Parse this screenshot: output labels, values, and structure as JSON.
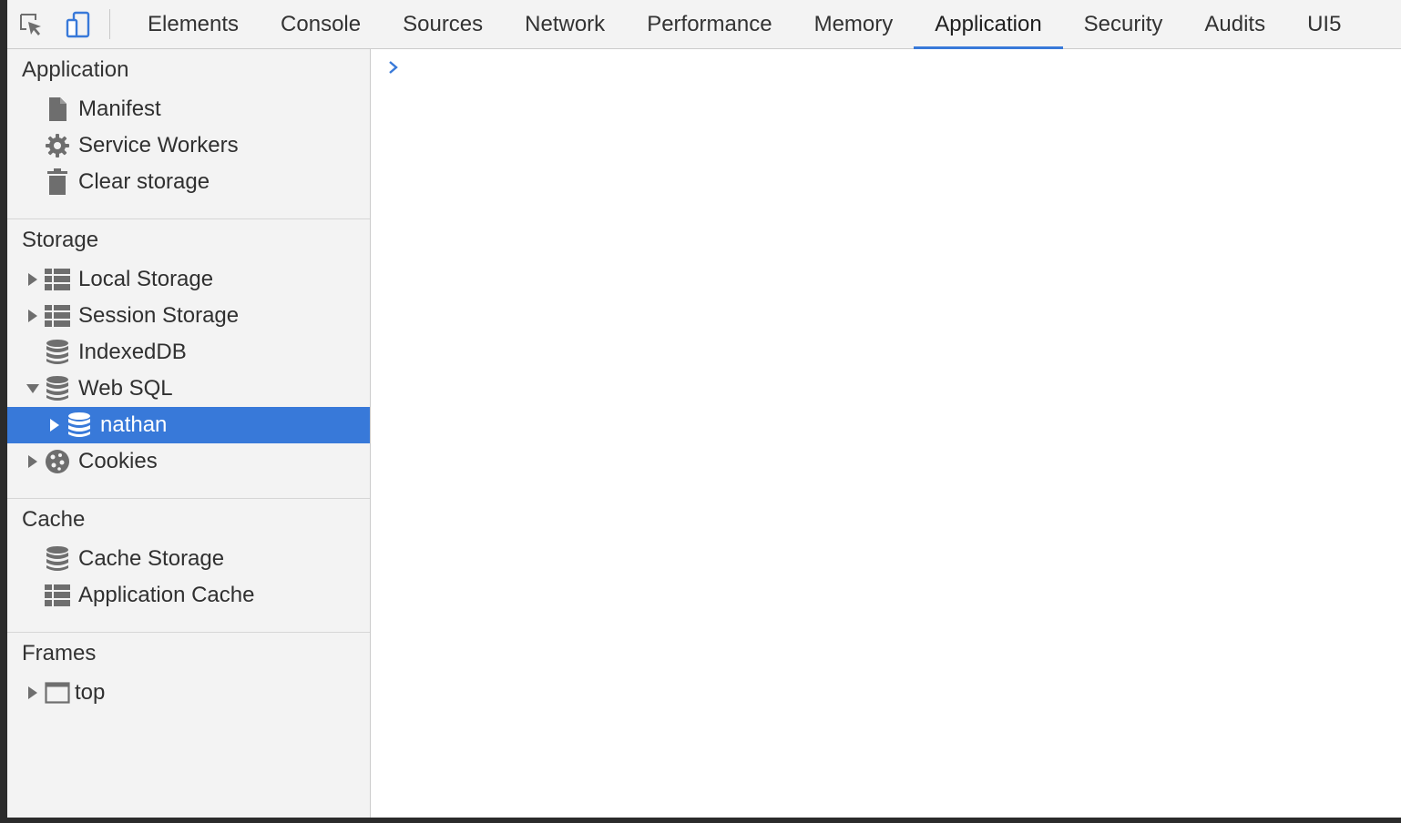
{
  "toolbar": {
    "tabs": [
      {
        "label": "Elements"
      },
      {
        "label": "Console"
      },
      {
        "label": "Sources"
      },
      {
        "label": "Network"
      },
      {
        "label": "Performance"
      },
      {
        "label": "Memory"
      },
      {
        "label": "Application"
      },
      {
        "label": "Security"
      },
      {
        "label": "Audits"
      },
      {
        "label": "UI5"
      }
    ],
    "active_tab": "Application"
  },
  "sidebar": {
    "application": {
      "title": "Application",
      "items": [
        {
          "label": "Manifest",
          "icon": "document-icon"
        },
        {
          "label": "Service Workers",
          "icon": "gear-icon"
        },
        {
          "label": "Clear storage",
          "icon": "trash-icon"
        }
      ]
    },
    "storage": {
      "title": "Storage",
      "items": [
        {
          "label": "Local Storage",
          "icon": "grid-icon"
        },
        {
          "label": "Session Storage",
          "icon": "grid-icon"
        },
        {
          "label": "IndexedDB",
          "icon": "database-icon"
        },
        {
          "label": "Web SQL",
          "icon": "database-icon"
        },
        {
          "label": "nathan",
          "icon": "database-icon"
        },
        {
          "label": "Cookies",
          "icon": "cookie-icon"
        }
      ]
    },
    "cache": {
      "title": "Cache",
      "items": [
        {
          "label": "Cache Storage",
          "icon": "database-icon"
        },
        {
          "label": "Application Cache",
          "icon": "grid-icon"
        }
      ]
    },
    "frames": {
      "title": "Frames",
      "items": [
        {
          "label": "top",
          "icon": "frame-icon"
        }
      ]
    }
  },
  "colors": {
    "accent": "#3879d9",
    "sidebar_bg": "#f3f3f3",
    "icon": "#6e6e6e"
  }
}
